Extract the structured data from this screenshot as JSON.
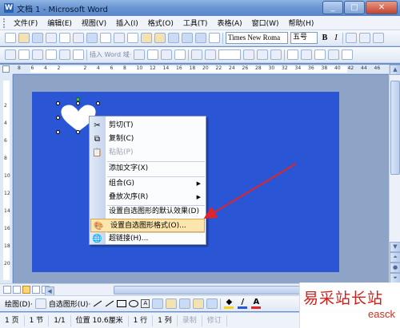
{
  "window": {
    "title": "文档 1 - Microsoft Word",
    "app_icon": "W",
    "buttons": [
      "_",
      "□",
      "✕"
    ]
  },
  "menubar": {
    "items": [
      "文件(F)",
      "编辑(E)",
      "视图(V)",
      "插入(I)",
      "格式(O)",
      "工具(T)",
      "表格(A)",
      "窗口(W)",
      "帮助(H)"
    ]
  },
  "toolbar": {
    "font_name": "Times New Roma",
    "font_size": "五号",
    "bold": "B",
    "italic": "I",
    "mail_merge_label": "插入 Word 域·"
  },
  "ruler": {
    "h_numbers": [
      "8",
      "6",
      "4",
      "2",
      "",
      "2",
      "4",
      "6",
      "8",
      "10",
      "12",
      "14",
      "16",
      "18",
      "20",
      "22",
      "24",
      "26",
      "28",
      "30",
      "32",
      "34",
      "36",
      "38",
      "40",
      "42",
      "44",
      "46"
    ],
    "v_numbers": [
      "2",
      "4",
      "6",
      "8",
      "10",
      "12",
      "14",
      "16",
      "18",
      "20"
    ]
  },
  "context_menu": {
    "items": [
      {
        "label": "剪切(T)",
        "icon": "✂",
        "disabled": false
      },
      {
        "label": "复制(C)",
        "icon": "⧉",
        "disabled": false
      },
      {
        "label": "粘贴(P)",
        "icon": "📋",
        "disabled": true
      },
      {
        "label": "添加文字(X)",
        "icon": "",
        "disabled": false
      },
      {
        "label": "组合(G)",
        "icon": "",
        "disabled": false,
        "submenu": "▶"
      },
      {
        "label": "叠放次序(R)",
        "icon": "",
        "disabled": false,
        "submenu": "▶"
      },
      {
        "label": "设置自选图形的默认效果(D)",
        "icon": "",
        "disabled": false
      },
      {
        "label": "设置自选图形格式(O)...",
        "icon": "🎨",
        "disabled": false,
        "highlighted": true
      },
      {
        "label": "超链接(H)...",
        "icon": "🌐",
        "disabled": false
      }
    ]
  },
  "drawbar": {
    "draw_label": "绘图(D)·",
    "autoshape_label": "自选图形(U)·",
    "textbox_glyph": "A",
    "font_color_glyph": "A"
  },
  "statusbar": {
    "page": "1 页",
    "section": "1 节",
    "page_of": "1/1",
    "position": "位置  10.6厘米",
    "line": "1 行",
    "column": "1 列",
    "rec": "录制",
    "trk": "修订"
  },
  "watermark": {
    "cn": "易采站长站",
    "en": "easck"
  },
  "colors": {
    "page_background": "#2a56d6",
    "menu_highlight": "#fde6ad",
    "arrow": "#e0242a"
  }
}
